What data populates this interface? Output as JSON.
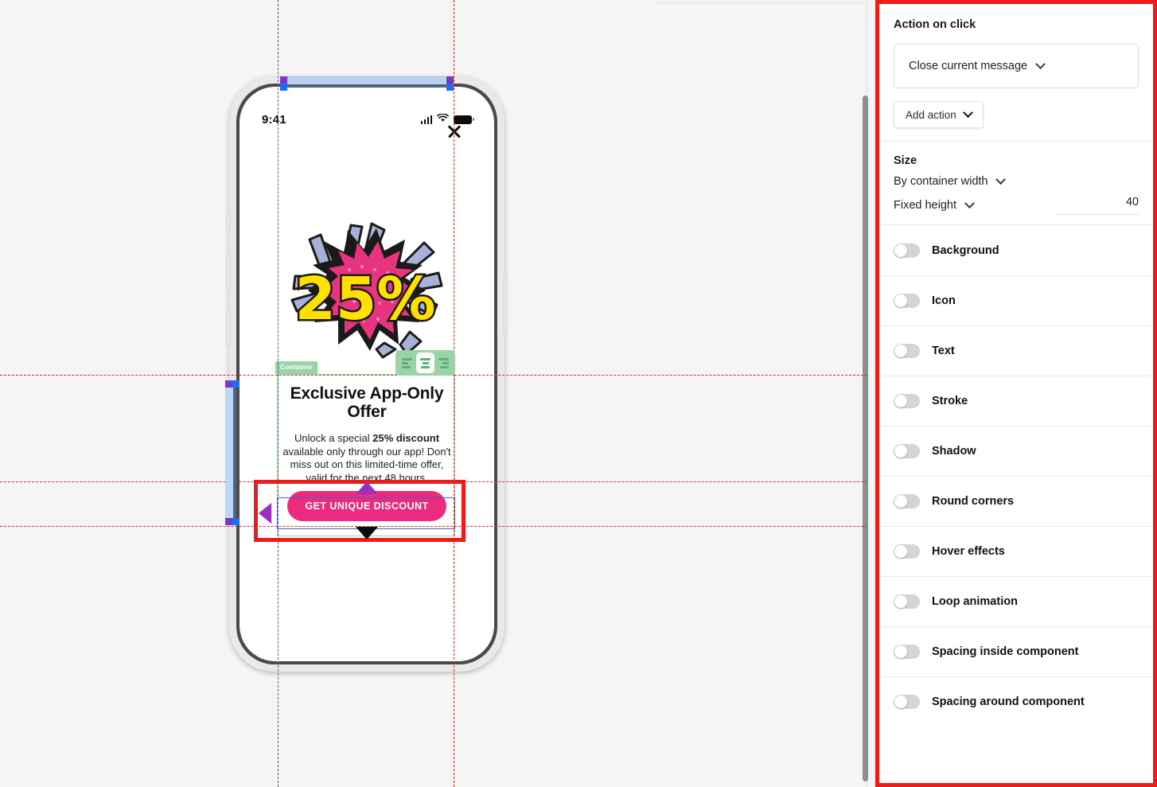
{
  "canvas": {
    "phone": {
      "status_bar": {
        "clock": "9:41",
        "signal_icon": "cellular-signal-icon",
        "wifi_icon": "wifi-icon",
        "battery_icon": "battery-icon"
      },
      "close_icon": "close-x-icon",
      "hero": {
        "icon": "twenty-five-percent-burst-graphic",
        "value": "25%"
      },
      "message": {
        "title": "Exclusive App-Only Offer",
        "body_part1": "Unlock a special ",
        "body_bold": "25% discount",
        "body_part2": " available only through our app! Don't miss out on this limited-time offer, valid for the next 48 hours.",
        "cta_label": "GET UNIQUE DISCOUNT"
      }
    },
    "overlay": {
      "container_tag": "Container",
      "align_buttons": [
        {
          "name": "align-left-button",
          "icon": "align-left-icon",
          "active": false
        },
        {
          "name": "align-center-button",
          "icon": "align-center-icon",
          "active": true
        },
        {
          "name": "align-right-button",
          "icon": "align-right-icon",
          "active": false
        }
      ],
      "selection_color": "#4a62b8",
      "container_color": "#9ad4a6",
      "highlight_color": "#ee1b1b",
      "arrow_color": "#9b2fc0"
    }
  },
  "panel": {
    "action_section": {
      "title": "Action on click",
      "select_value": "Close current message",
      "select_icon": "chevron-down-icon",
      "add_action_label": "Add action",
      "add_action_icon": "chevron-down-icon"
    },
    "size_section": {
      "title": "Size",
      "width_value": "By container width",
      "width_icon": "chevron-down-icon",
      "height_value": "Fixed height",
      "height_icon": "chevron-down-icon",
      "height_number": "40"
    },
    "toggles": [
      {
        "label": "Background",
        "on": false
      },
      {
        "label": "Icon",
        "on": false
      },
      {
        "label": "Text",
        "on": false
      },
      {
        "label": "Stroke",
        "on": false
      },
      {
        "label": "Shadow",
        "on": false
      },
      {
        "label": "Round corners",
        "on": false
      },
      {
        "label": "Hover effects",
        "on": false
      },
      {
        "label": "Loop animation",
        "on": false
      },
      {
        "label": "Spacing inside component",
        "on": false
      },
      {
        "label": "Spacing around component",
        "on": false
      }
    ]
  }
}
